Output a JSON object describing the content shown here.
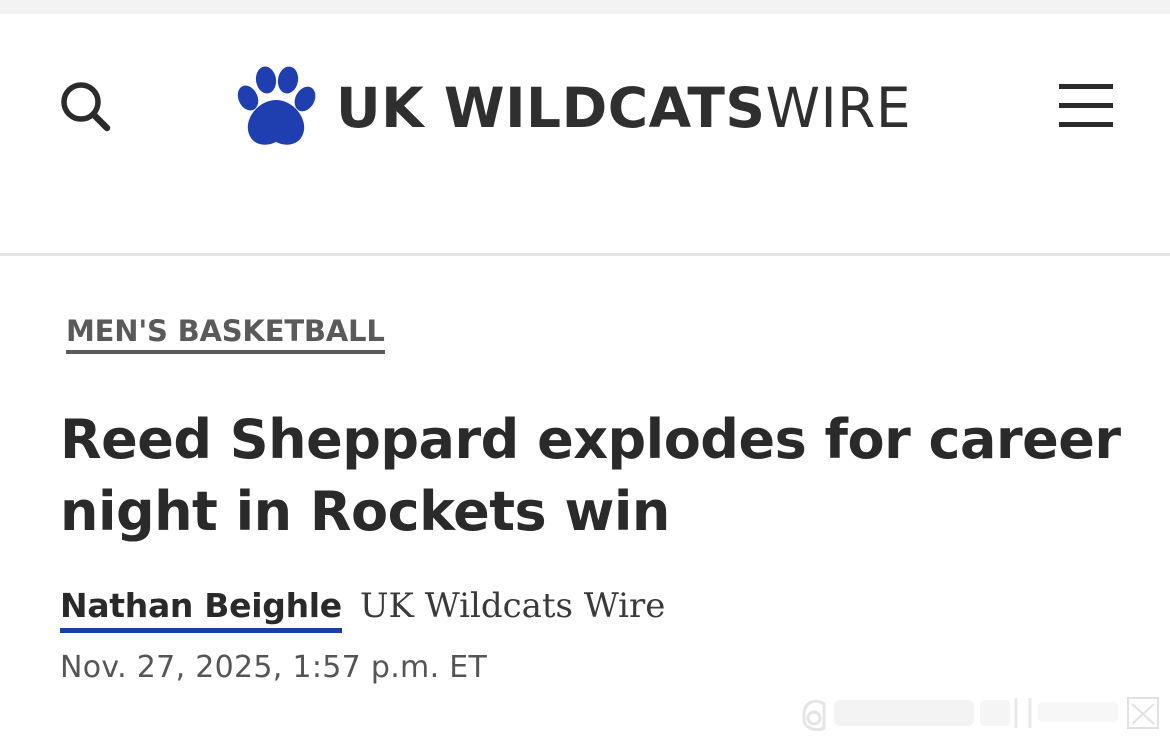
{
  "header": {
    "logo_bold": "UK WILDCATS",
    "logo_light": "WIRE",
    "search_icon": "search-icon",
    "menu_icon": "hamburger-menu-icon",
    "logo_icon": "paw-print-icon",
    "brand_color": "#1f3fb0"
  },
  "article": {
    "category": "MEN'S BASKETBALL",
    "headline": "Reed Sheppard explodes for career night in Rockets win",
    "author": "Nathan Beighle",
    "publication": "UK Wildcats Wire",
    "timestamp": "Nov. 27, 2025, 1:57 p.m. ET",
    "author_underline_color": "#1a3fa8"
  }
}
